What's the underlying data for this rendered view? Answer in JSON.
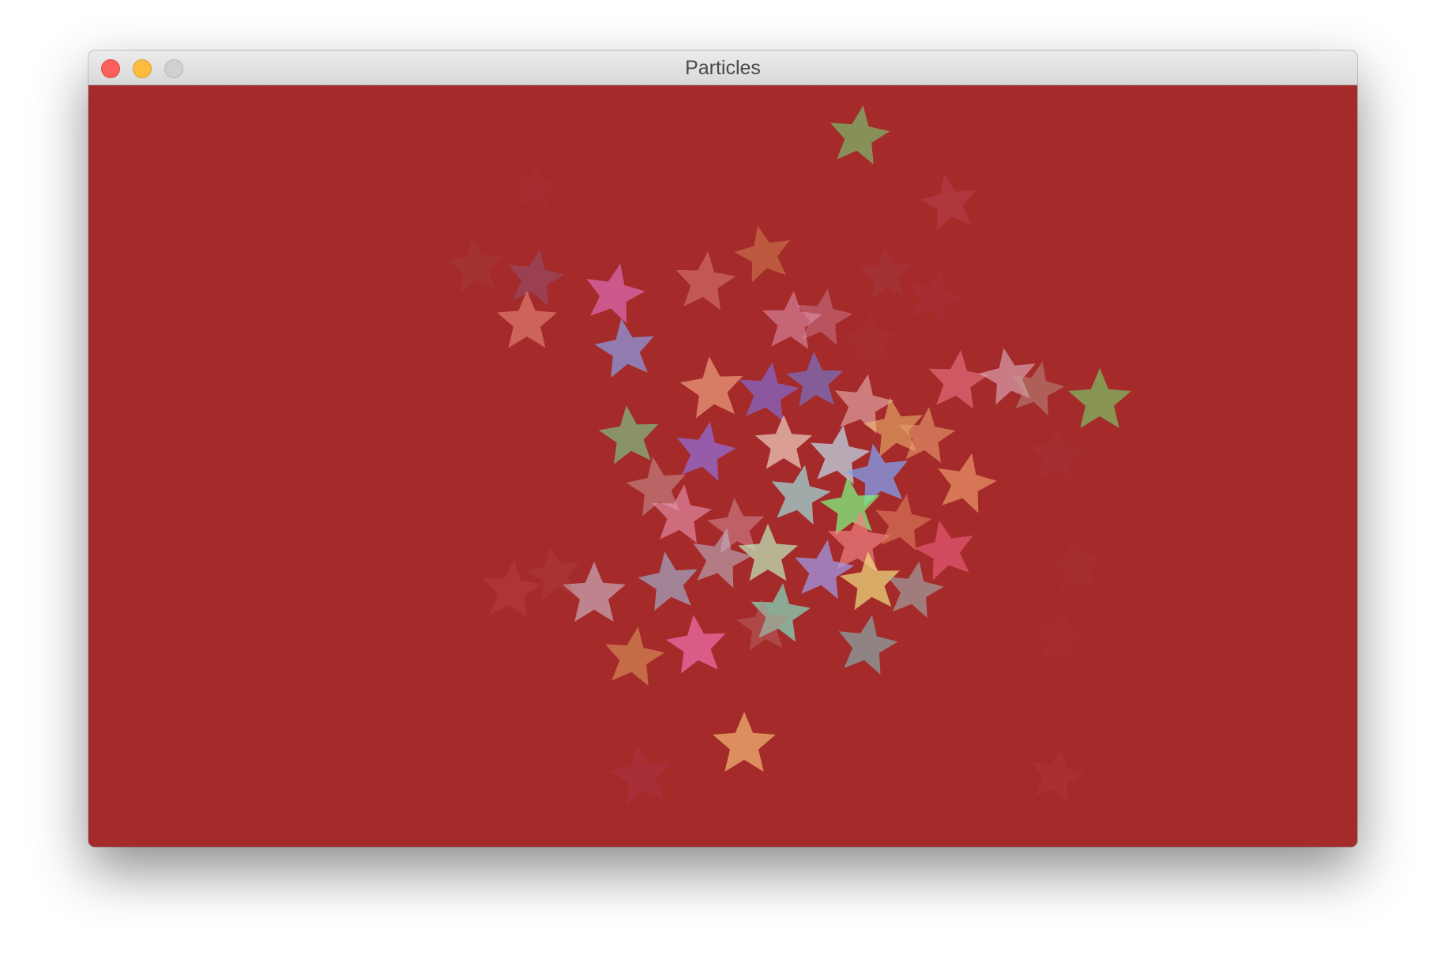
{
  "window": {
    "title": "Particles",
    "controls": {
      "close": "close-button",
      "minimize": "minimize-button",
      "zoom": "zoom-button"
    }
  },
  "canvas": {
    "background_color": "#a52a2a",
    "particle_shape": "star-icon"
  }
}
